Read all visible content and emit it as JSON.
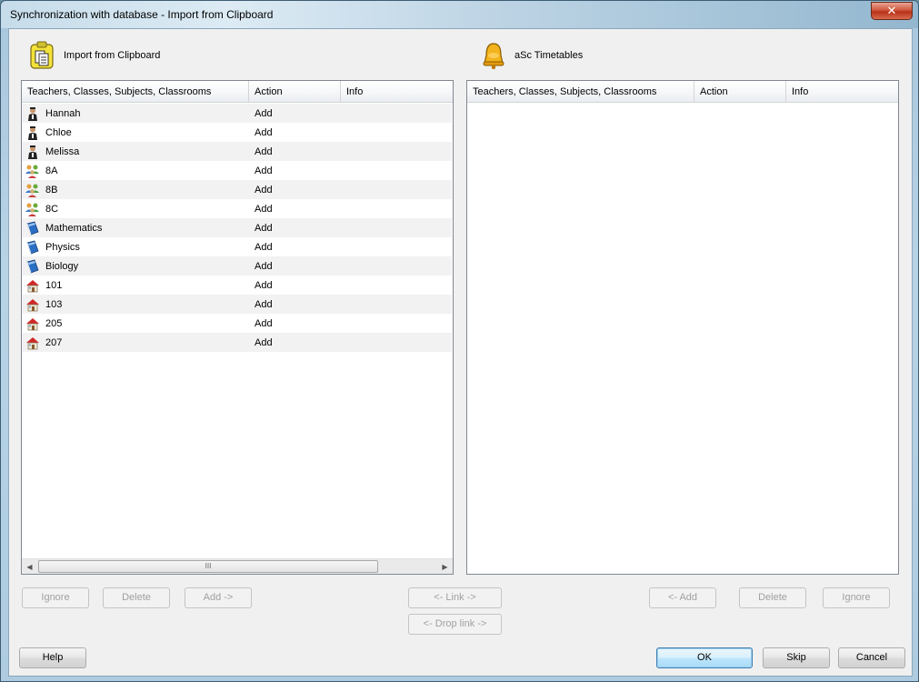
{
  "window": {
    "title": "Synchronization with database - Import from Clipboard",
    "close_glyph": "✕"
  },
  "left_panel": {
    "title": "Import from Clipboard",
    "icon": "clipboard-icon",
    "columns": [
      "Teachers, Classes, Subjects, Classrooms",
      "Action",
      "Info"
    ],
    "rows": [
      {
        "icon": "teacher-icon",
        "name": "Hannah",
        "action": "Add",
        "info": ""
      },
      {
        "icon": "teacher-icon",
        "name": "Chloe",
        "action": "Add",
        "info": ""
      },
      {
        "icon": "teacher-icon",
        "name": "Melissa",
        "action": "Add",
        "info": ""
      },
      {
        "icon": "class-icon",
        "name": "8A",
        "action": "Add",
        "info": ""
      },
      {
        "icon": "class-icon",
        "name": "8B",
        "action": "Add",
        "info": ""
      },
      {
        "icon": "class-icon",
        "name": "8C",
        "action": "Add",
        "info": ""
      },
      {
        "icon": "subject-icon",
        "name": "Mathematics",
        "action": "Add",
        "info": ""
      },
      {
        "icon": "subject-icon",
        "name": "Physics",
        "action": "Add",
        "info": ""
      },
      {
        "icon": "subject-icon",
        "name": "Biology",
        "action": "Add",
        "info": ""
      },
      {
        "icon": "classroom-icon",
        "name": "101",
        "action": "Add",
        "info": ""
      },
      {
        "icon": "classroom-icon",
        "name": "103",
        "action": "Add",
        "info": ""
      },
      {
        "icon": "classroom-icon",
        "name": "205",
        "action": "Add",
        "info": ""
      },
      {
        "icon": "classroom-icon",
        "name": "207",
        "action": "Add",
        "info": ""
      }
    ],
    "scroll_left": "◀",
    "scroll_right": "▶",
    "scroll_thumb_grip": "III"
  },
  "right_panel": {
    "title": "aSc Timetables",
    "icon": "bell-icon",
    "columns": [
      "Teachers, Classes, Subjects, Classrooms",
      "Action",
      "Info"
    ],
    "rows": []
  },
  "buttons": {
    "ignore_left": "Ignore",
    "delete_left": "Delete",
    "add_right_arrow": "Add ->",
    "link": "<- Link ->",
    "drop_link": "<- Drop link ->",
    "add_left_arrow": "<- Add",
    "delete_right": "Delete",
    "ignore_right": "Ignore",
    "help": "Help",
    "ok": "OK",
    "skip": "Skip",
    "cancel": "Cancel"
  },
  "colors": {
    "title_bar": "#c6dcea",
    "close_button": "#c8472c",
    "dialog_bg": "#f0f0f0",
    "default_button": "#3c7fb1"
  }
}
